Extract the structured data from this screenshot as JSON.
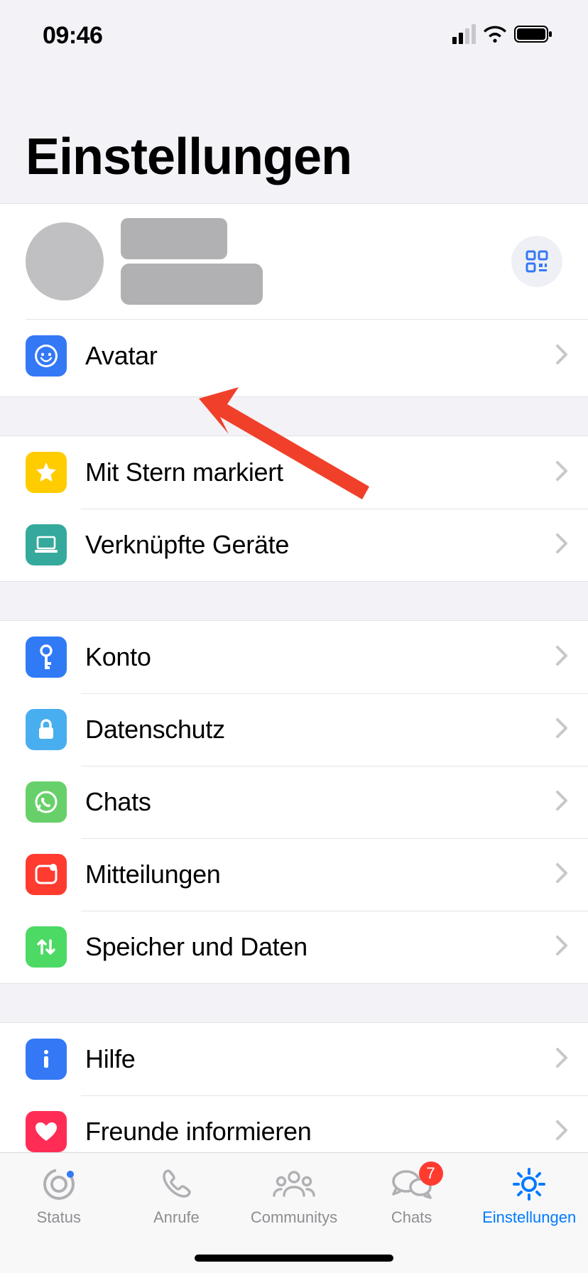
{
  "status": {
    "time": "09:46"
  },
  "header": {
    "title": "Einstellungen"
  },
  "profile": {
    "qr_label": "qr-code"
  },
  "rows": {
    "avatar": "Avatar",
    "starred": "Mit Stern markiert",
    "linked": "Verknüpfte Geräte",
    "account": "Konto",
    "privacy": "Datenschutz",
    "chats": "Chats",
    "notifications": "Mitteilungen",
    "storage": "Speicher und Daten",
    "help": "Hilfe",
    "tell": "Freunde informieren"
  },
  "tabs": {
    "status": "Status",
    "calls": "Anrufe",
    "communities": "Communitys",
    "chats": "Chats",
    "chats_badge": "7",
    "settings": "Einstellungen"
  }
}
